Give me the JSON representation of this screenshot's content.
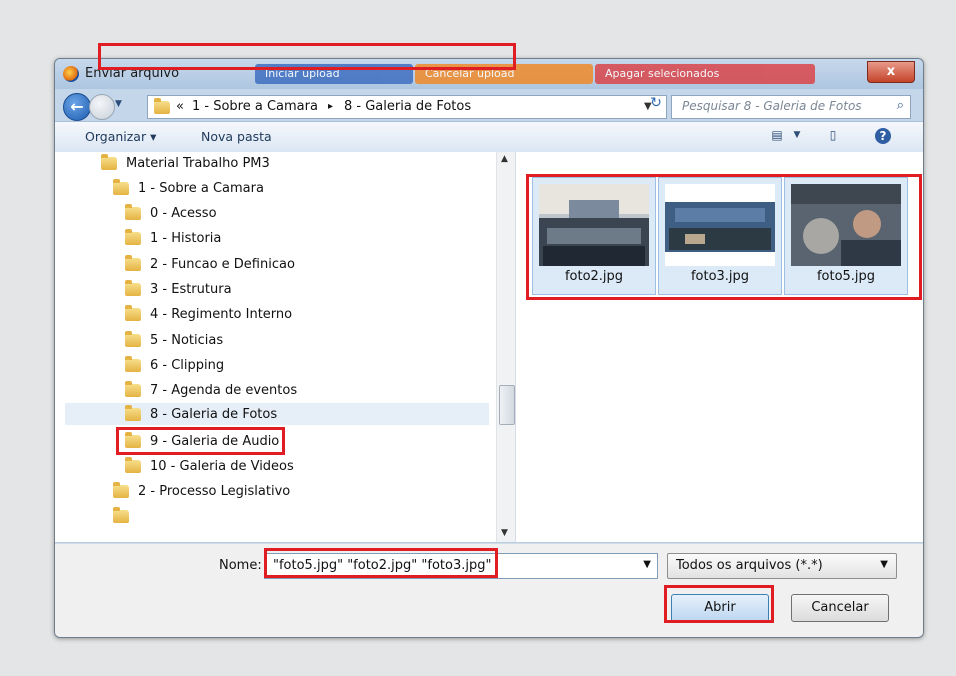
{
  "dialog": {
    "title": "Enviar arquivo",
    "blurred_buttons": [
      "Iniciar upload",
      "Cancelar upload",
      "Apagar selecionados"
    ],
    "close_label": "x"
  },
  "address": {
    "overflow": "«",
    "crumbs": [
      "1 - Sobre a Camara",
      "8 - Galeria de Fotos"
    ],
    "separator": "▸",
    "search_placeholder": "Pesquisar 8 - Galeria de Fotos"
  },
  "toolbar": {
    "organize": "Organizar ▾",
    "new_folder": "Nova pasta"
  },
  "tree": {
    "items": [
      {
        "label": "Material Trabalho PM3"
      },
      {
        "label": "1 - Sobre a Camara"
      },
      {
        "label": "0 - Acesso"
      },
      {
        "label": "1 - Historia"
      },
      {
        "label": "2 - Funcao e Definicao"
      },
      {
        "label": "3 - Estrutura"
      },
      {
        "label": "4 - Regimento Interno"
      },
      {
        "label": "5 - Noticias"
      },
      {
        "label": "6 - Clipping"
      },
      {
        "label": "7 - Agenda de eventos"
      },
      {
        "label": "8 - Galeria de Fotos"
      },
      {
        "label": "9 - Galeria de Audio"
      },
      {
        "label": "10 - Galeria de Videos"
      },
      {
        "label": "2 - Processo Legislativo"
      }
    ]
  },
  "files": [
    {
      "name": "foto2.jpg"
    },
    {
      "name": "foto3.jpg"
    },
    {
      "name": "foto5.jpg"
    }
  ],
  "bottom": {
    "name_label": "Nome:",
    "name_value": "\"foto5.jpg\" \"foto2.jpg\" \"foto3.jpg\"",
    "file_type": "Todos os arquivos (*.*)",
    "open_label": "Abrir",
    "cancel_label": "Cancelar"
  },
  "colors": {
    "highlight": "#e01d22",
    "dialog_frame": "#b7cde3"
  }
}
